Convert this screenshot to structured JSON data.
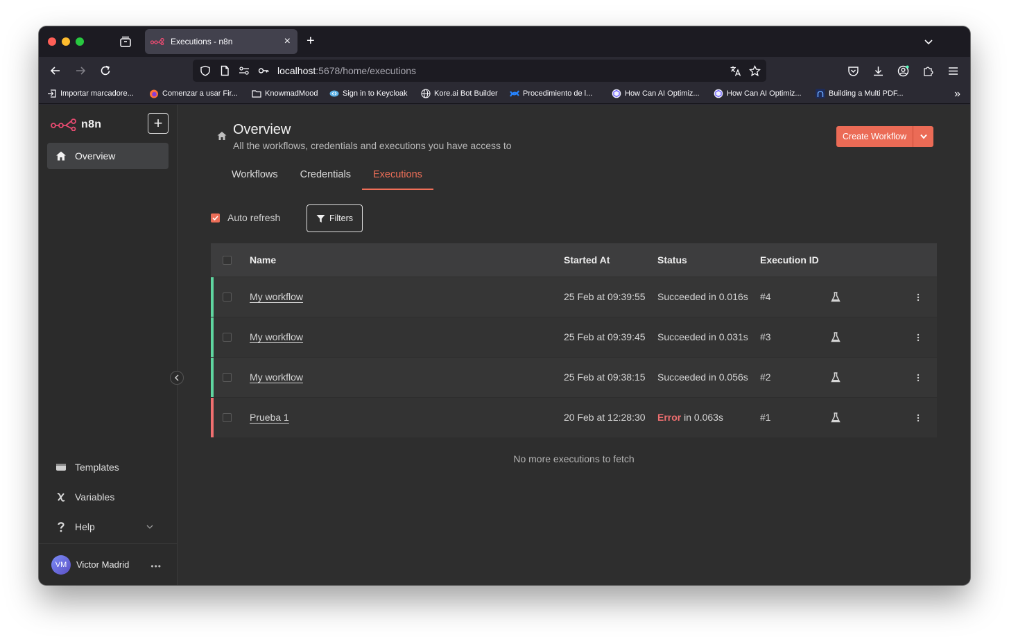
{
  "browser": {
    "tab_title": "Executions - n8n",
    "url_host": "localhost",
    "url_path": ":5678/home/executions",
    "bookmarks": [
      "Importar marcadore...",
      "Comenzar a usar Fir...",
      "KnowmadMood",
      "Sign in to Keycloak",
      "Kore.ai Bot Builder",
      "Procedimiento de l...",
      "How Can AI Optimiz...",
      "How Can AI Optimiz...",
      "Building a Multi PDF..."
    ]
  },
  "app": {
    "logo_text": "n8n",
    "add_label": "+",
    "sidebar": {
      "overview": "Overview",
      "templates": "Templates",
      "variables": "Variables",
      "help": "Help"
    },
    "user": {
      "initials": "VM",
      "name": "Victor Madrid",
      "menu": "•••"
    }
  },
  "overview": {
    "title": "Overview",
    "subtitle": "All the workflows, credentials and executions you have access to",
    "create_button": "Create Workflow",
    "tabs": [
      "Workflows",
      "Credentials",
      "Executions"
    ],
    "active_tab": "Executions"
  },
  "executions": {
    "auto_refresh_label": "Auto refresh",
    "auto_refresh_checked": true,
    "filters_label": "Filters",
    "columns": {
      "name": "Name",
      "started": "Started At",
      "status": "Status",
      "id": "Execution ID"
    },
    "rows": [
      {
        "name": "My workflow",
        "started": "25 Feb at 09:39:55",
        "status_word": "Succeeded",
        "status_rest": " in 0.016s",
        "id": "#4",
        "result": "success"
      },
      {
        "name": "My workflow",
        "started": "25 Feb at 09:39:45",
        "status_word": "Succeeded",
        "status_rest": " in 0.031s",
        "id": "#3",
        "result": "success"
      },
      {
        "name": "My workflow",
        "started": "25 Feb at 09:38:15",
        "status_word": "Succeeded",
        "status_rest": " in 0.056s",
        "id": "#2",
        "result": "success"
      },
      {
        "name": "Prueba 1",
        "started": "20 Feb at 12:28:30",
        "status_word": "Error",
        "status_rest": " in 0.063s",
        "id": "#1",
        "result": "error"
      }
    ],
    "footer": "No more executions to fetch"
  },
  "colors": {
    "accent": "#ef6f58",
    "success": "#5fd6a0",
    "error": "#f06f70"
  }
}
